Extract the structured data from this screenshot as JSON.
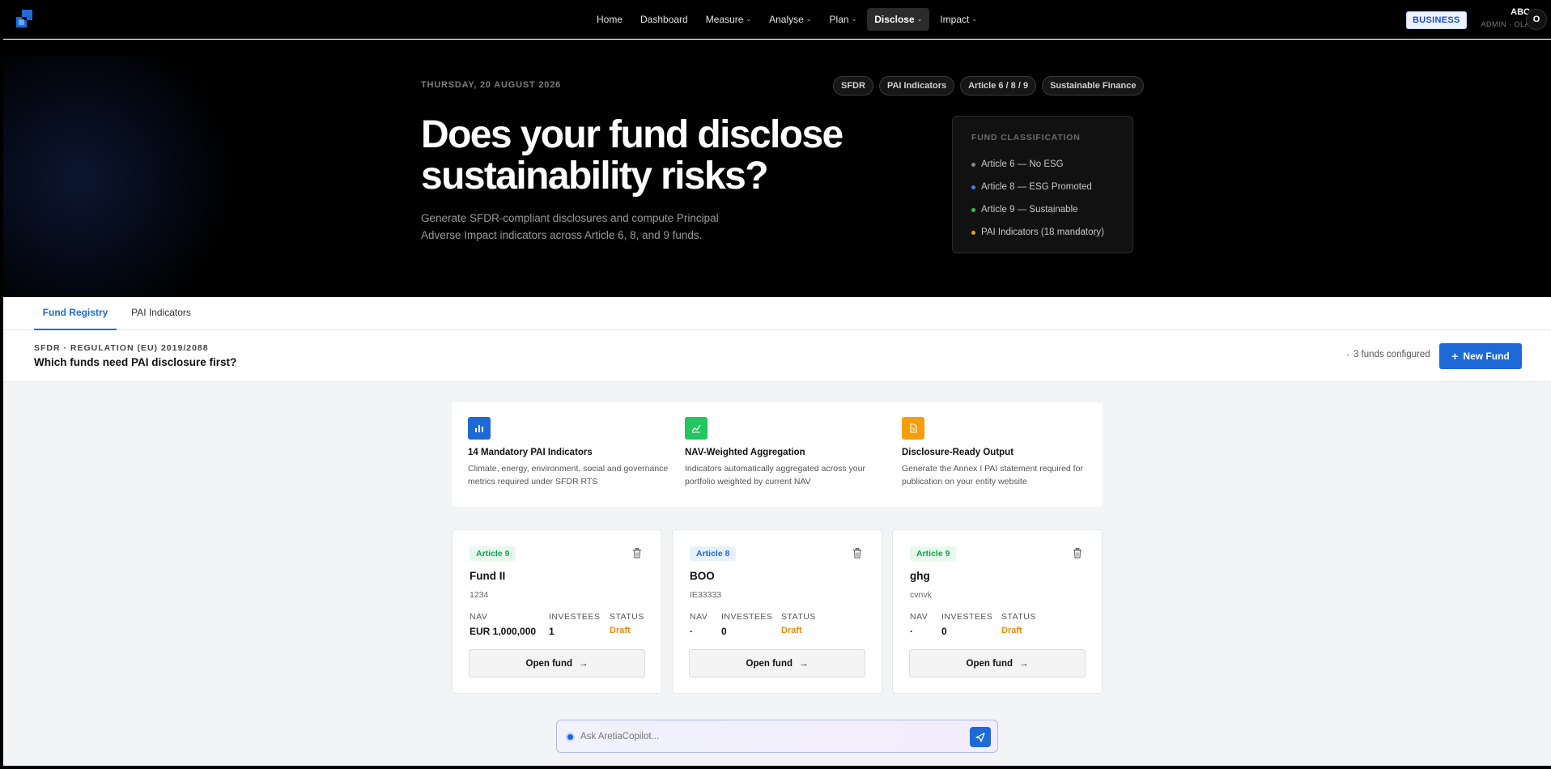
{
  "nav": {
    "logo_icon": "app-logo-icon",
    "links": [
      {
        "label": "Home",
        "dropdown": false,
        "active": false
      },
      {
        "label": "Dashboard",
        "dropdown": false,
        "active": false
      },
      {
        "label": "Measure",
        "dropdown": true,
        "active": false
      },
      {
        "label": "Analyse",
        "dropdown": true,
        "active": false
      },
      {
        "label": "Plan",
        "dropdown": true,
        "active": false
      },
      {
        "label": "Disclose",
        "dropdown": true,
        "active": true
      },
      {
        "label": "Impact",
        "dropdown": true,
        "active": false
      }
    ],
    "plan_badge": "BUSINESS",
    "org": "ABC",
    "role": "ADMIN · OLA",
    "avatar": "O"
  },
  "hero": {
    "date": "THURSDAY, 20 AUGUST 2026",
    "tags": [
      "SFDR",
      "PAI Indicators",
      "Article 6 / 8 / 9",
      "Sustainable Finance"
    ],
    "title": "Does your fund disclose sustainability risks?",
    "subtitle": "Generate SFDR-compliant disclosures and compute Principal Adverse Impact indicators across Article 6, 8, and 9 funds.",
    "classification": {
      "title": "FUND CLASSIFICATION",
      "items": [
        {
          "label": "Article 6 — No ESG",
          "color": "#8a8a8a"
        },
        {
          "label": "Article 8 — ESG Promoted",
          "color": "#3b82f6"
        },
        {
          "label": "Article 9 — Sustainable",
          "color": "#22c55e"
        },
        {
          "label": "PAI Indicators (18 mandatory)",
          "color": "#f59e0b"
        }
      ]
    }
  },
  "tabs": [
    {
      "label": "Fund Registry",
      "active": true
    },
    {
      "label": "PAI Indicators",
      "active": false
    }
  ],
  "section": {
    "kicker": "SFDR · REGULATION (EU) 2019/2088",
    "title": "Which funds need PAI disclosure first?",
    "fund_count": "3 funds configured",
    "new_fund_label": "New Fund"
  },
  "features": [
    {
      "icon": "bar-chart-icon",
      "color": "#1d6ad6",
      "title": "14 Mandatory PAI Indicators",
      "desc": "Climate, energy, environment, social and governance metrics required under SFDR RTS"
    },
    {
      "icon": "line-chart-icon",
      "color": "#22c55e",
      "title": "NAV-Weighted Aggregation",
      "desc": "Indicators automatically aggregated across your portfolio weighted by current NAV"
    },
    {
      "icon": "document-icon",
      "color": "#f59e0b",
      "title": "Disclosure-Ready Output",
      "desc": "Generate the Annex I PAI statement required for publication on your entity website"
    }
  ],
  "metric_labels": {
    "nav": "NAV",
    "investees": "INVESTEES",
    "status": "STATUS"
  },
  "funds": [
    {
      "article": "Article 9",
      "name": "Fund II",
      "code": "1234",
      "nav": "EUR 1,000,000",
      "investees": "1",
      "status": "Draft",
      "open_label": "Open fund"
    },
    {
      "article": "Article 8",
      "name": "BOO",
      "code": "IE33333",
      "nav": "·",
      "investees": "0",
      "status": "Draft",
      "open_label": "Open fund"
    },
    {
      "article": "Article 9",
      "name": "ghg",
      "code": "cvnvk",
      "nav": "·",
      "investees": "0",
      "status": "Draft",
      "open_label": "Open fund"
    }
  ],
  "copilot": {
    "placeholder": "Ask AretiaCopilot..."
  }
}
